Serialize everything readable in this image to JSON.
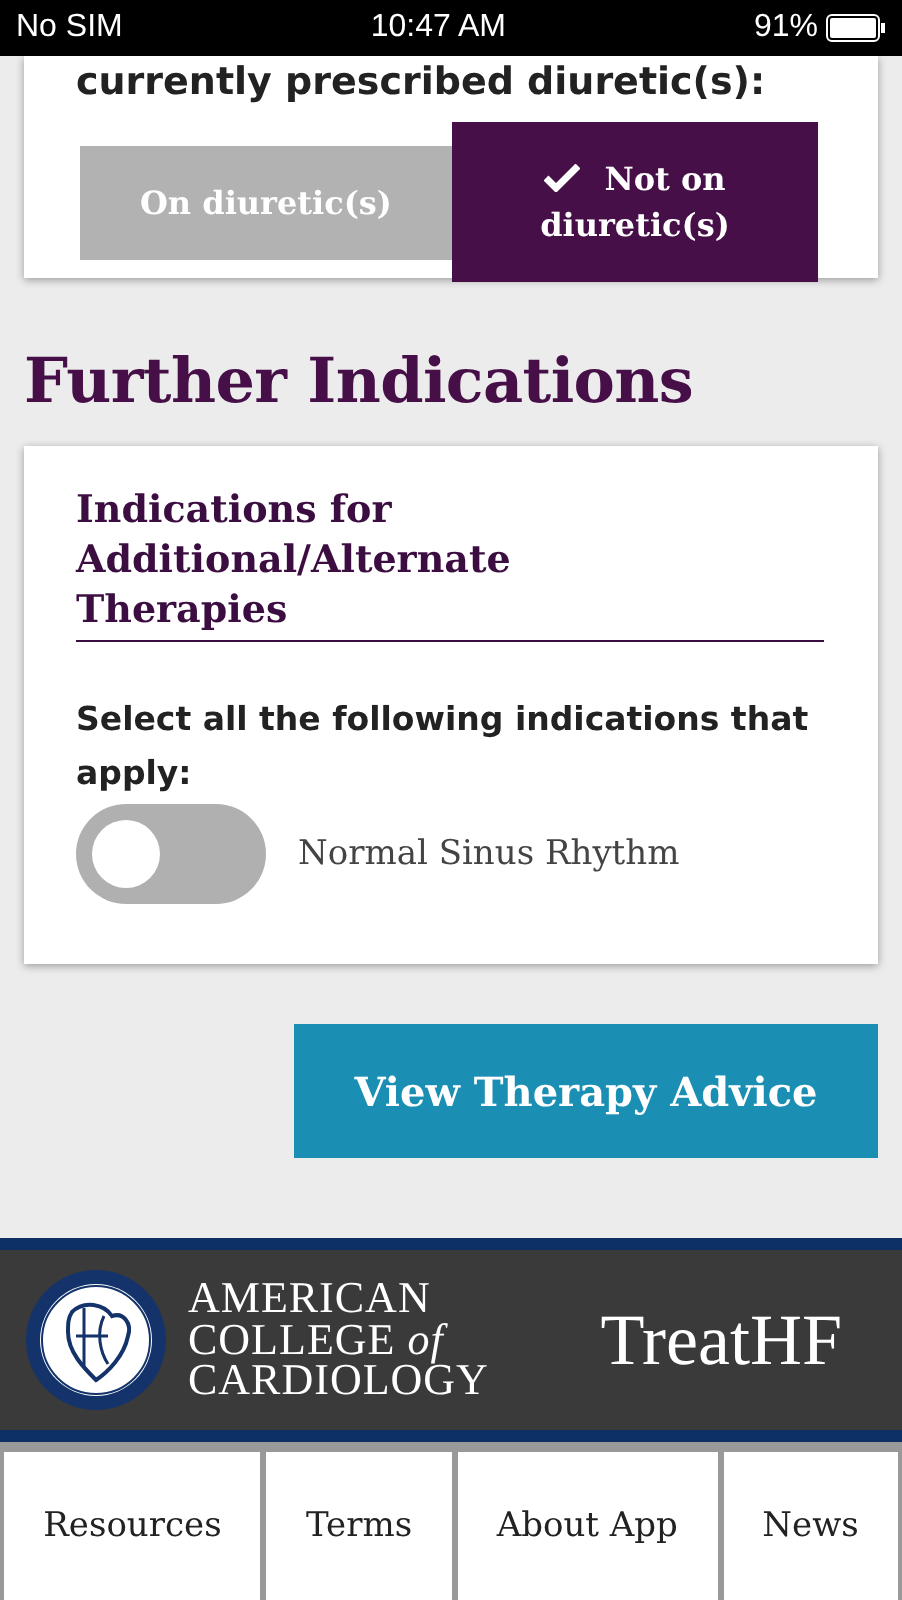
{
  "status_bar": {
    "carrier": "No SIM",
    "time": "10:47 AM",
    "battery": "91%"
  },
  "diuretic_card": {
    "prompt": "currently prescribed diuretic(s):",
    "options": [
      {
        "label": "On diuretic(s)",
        "selected": false
      },
      {
        "label": "Not on diuretic(s)",
        "selected": true
      }
    ]
  },
  "section_title": "Further Indications",
  "indications_card": {
    "title": "Indications for Additional/Alternate Therapies",
    "instruction": "Select all the following indications that apply:",
    "toggles": [
      {
        "label": "Normal Sinus Rhythm",
        "on": false
      }
    ]
  },
  "action_button": "View Therapy Advice",
  "footer": {
    "org_lines": [
      "AMERICAN",
      "COLLEGE *of*",
      "CARDIOLOGY"
    ],
    "app_name": "TreatHF"
  },
  "nav": [
    "Resources",
    "Terms",
    "About App",
    "News"
  ]
}
